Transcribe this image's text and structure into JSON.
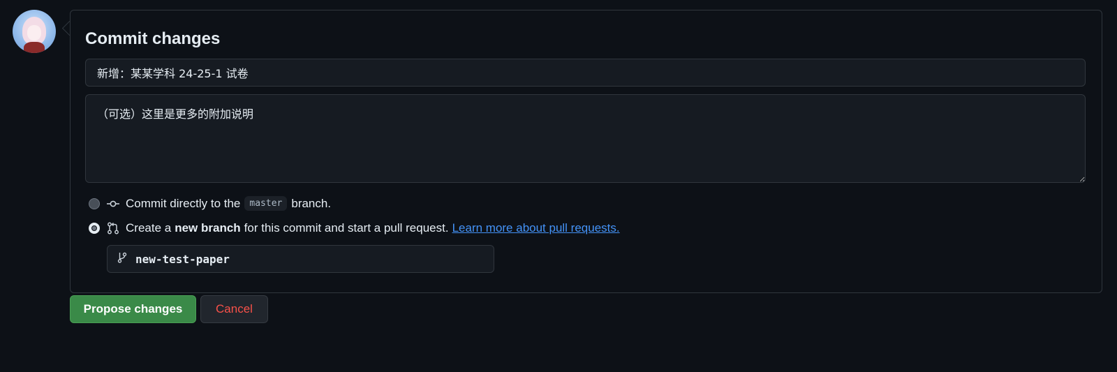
{
  "commit_panel": {
    "title": "Commit changes",
    "summary_value": "新增：某某学科 24-25-1 试卷",
    "description_value": "（可选）这里是更多的附加说明",
    "option_direct": {
      "prefix": "Commit directly to the",
      "branch": "master",
      "suffix": "branch.",
      "icon": "git-commit-icon"
    },
    "option_new_branch": {
      "prefix": "Create a",
      "bold": "new branch",
      "suffix": "for this commit and start a pull request.",
      "link": "Learn more about pull requests.",
      "icon": "git-pull-request-icon"
    },
    "selected_option": "new_branch",
    "branch_name": "new-test-paper"
  },
  "actions": {
    "propose_label": "Propose changes",
    "cancel_label": "Cancel"
  },
  "colors": {
    "background": "#0d1117",
    "primary_button": "#3a8a48",
    "danger_text": "#f85149",
    "link": "#4493f8"
  }
}
